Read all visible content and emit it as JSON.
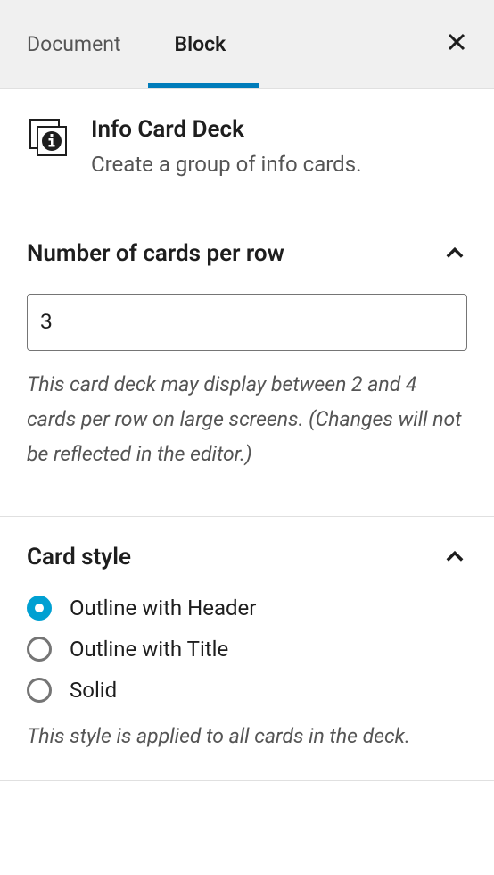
{
  "tabs": {
    "document": "Document",
    "block": "Block"
  },
  "block_header": {
    "title": "Info Card Deck",
    "description": "Create a group of info cards."
  },
  "panel_cards_per_row": {
    "title": "Number of cards per row",
    "value": "3",
    "help": "This card deck may display between 2 and 4 cards per row on large screens. (Changes will not be reflected in the editor.)"
  },
  "panel_card_style": {
    "title": "Card style",
    "options": {
      "outline_header": "Outline with Header",
      "outline_title": "Outline with Title",
      "solid": "Solid"
    },
    "help": "This style is applied to all cards in the deck."
  }
}
